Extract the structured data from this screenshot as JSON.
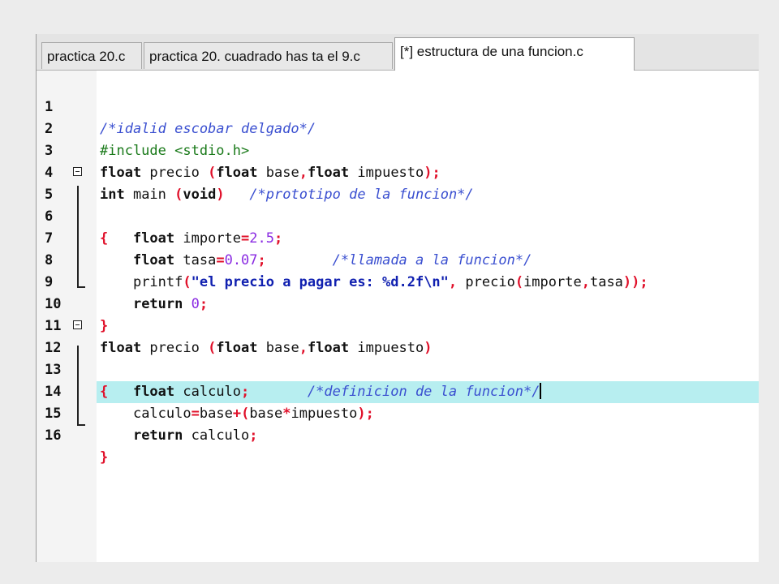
{
  "tabs": [
    {
      "label": "practica 20.c"
    },
    {
      "label": "practica 20. cuadrado has ta el 9.c"
    },
    {
      "label": "[*] estructura de una funcion.c"
    }
  ],
  "line_numbers": [
    "1",
    "2",
    "3",
    "4",
    "5",
    "6",
    "7",
    "8",
    "9",
    "10",
    "11",
    "12",
    "13",
    "14",
    "15",
    "16"
  ],
  "code": {
    "l1": {
      "comment": "/*idalid escobar delgado*/"
    },
    "l2": {
      "include": "#include <stdio.h>"
    },
    "l3": {
      "t1": "float",
      "t2": " precio ",
      "p1": "(",
      "t3": "float",
      "t4": " base",
      "p2": ",",
      "t5": "float",
      "t6": " impuesto",
      "p3": ");"
    },
    "l4": {
      "t1": "int",
      "t2": " main ",
      "p1": "(",
      "t3": "void",
      "p2": ")",
      "sp": "   ",
      "comment": "/*prototipo de la funcion*/"
    },
    "l5": {
      "brace": "{"
    },
    "l6": {
      "indent": "    ",
      "t1": "float",
      "t2": " importe",
      "op": "=",
      "num": "2.5",
      "semi": ";"
    },
    "l7": {
      "indent": "    ",
      "t1": "float",
      "t2": " tasa",
      "op": "=",
      "num": "0.07",
      "semi": ";",
      "sp": "        ",
      "comment": "/*llamada a la funcion*/"
    },
    "l8": {
      "indent": "    ",
      "t1": "printf",
      "p1": "(",
      "str": "\"el precio a pagar es: %d.2f\\n\"",
      "comma": ",",
      "t2": " precio",
      "p2": "(",
      "t3": "importe",
      "comma2": ",",
      "t4": "tasa",
      "p3": "));"
    },
    "l9": {
      "indent": "    ",
      "t1": "return",
      "sp": " ",
      "num": "0",
      "semi": ";"
    },
    "l10": {
      "brace": "}"
    },
    "l11": {
      "t1": "float",
      "t2": " precio ",
      "p1": "(",
      "t3": "float",
      "t4": " base",
      "p2": ",",
      "t5": "float",
      "t6": " impuesto",
      "p3": ")"
    },
    "l12": {
      "brace": "{",
      "sp": "                        ",
      "comment": "/*definicion de la funcion*/"
    },
    "l13": {
      "indent": "    ",
      "t1": "float",
      "t2": " calculo",
      "semi": ";"
    },
    "l14": {
      "indent": "    ",
      "t1": "calculo",
      "op1": "=",
      "t2": "base",
      "op2": "+",
      "p1": "(",
      "t3": "base",
      "op3": "*",
      "t4": "impuesto",
      "p2": ");"
    },
    "l15": {
      "indent": "    ",
      "t1": "return",
      "t2": " calculo",
      "semi": ";"
    },
    "l16": {
      "brace": "}"
    }
  },
  "colors": {
    "highlight_line": "#b7eef0",
    "comment": "#3a4fd0",
    "string": "#1020b0",
    "number": "#8a2be2",
    "operator": "#e0102a",
    "preprocessor": "#1a7a1a"
  }
}
